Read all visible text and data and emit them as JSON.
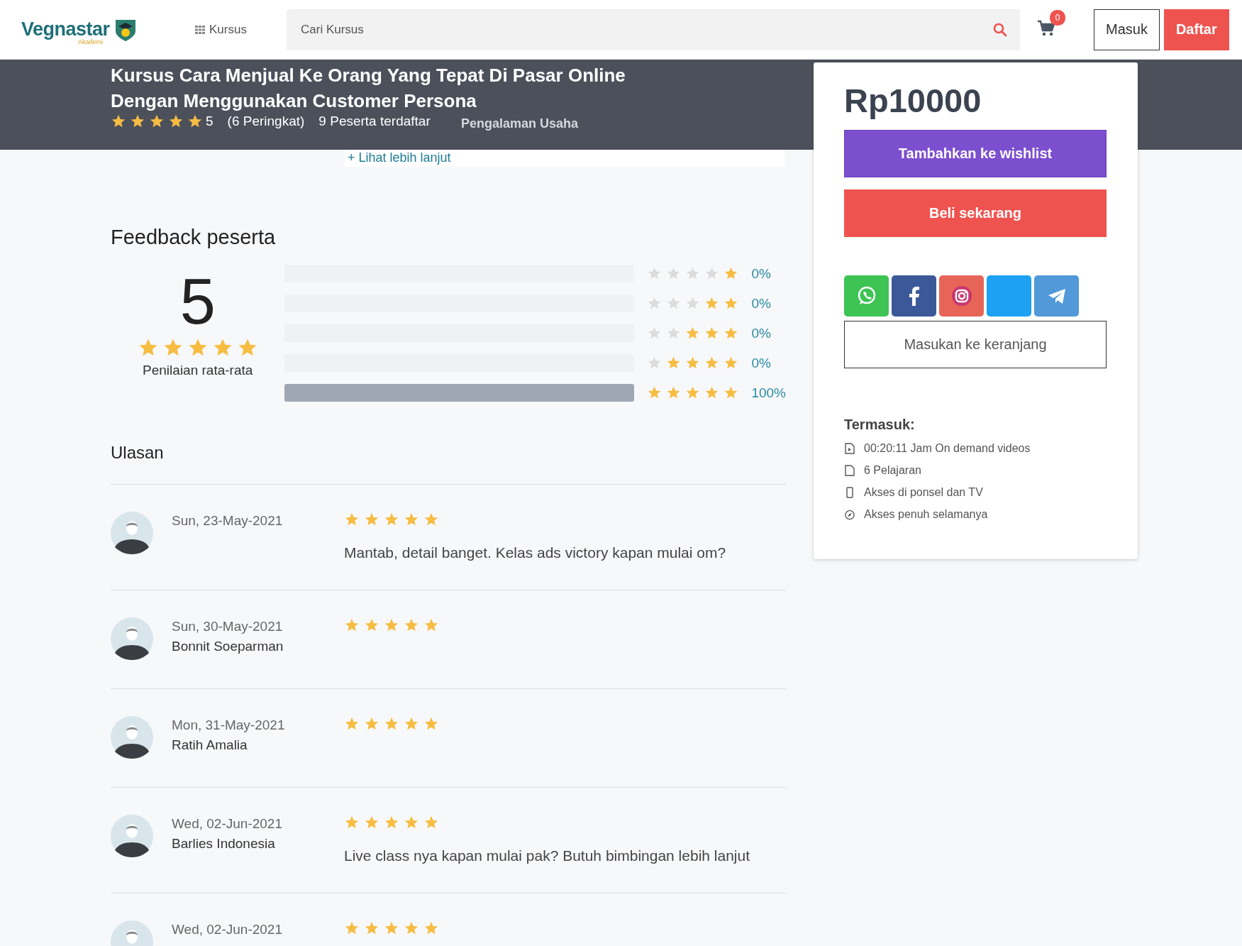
{
  "header": {
    "logo": {
      "name": "Vegnastar",
      "tagline": "Akademi"
    },
    "nav_link": "Kursus",
    "search": {
      "placeholder": "Cari Kursus"
    },
    "cart": {
      "count": "0"
    },
    "buttons": [
      {
        "label": "Masuk",
        "kind": "outline"
      },
      {
        "label": "Daftar",
        "kind": "primary"
      }
    ]
  },
  "course": {
    "title": "Kursus Cara Menjual Ke Orang Yang Tepat Di Pasar Online Dengan Menggunakan Customer Persona",
    "stars": 5,
    "rating": "5",
    "ratings_count": "(6 Peringkat)",
    "enrolled": "9 Peserta terdaftar"
  },
  "about_fragment": {
    "heading": "Pengalaman Usaha",
    "link": "+ Lihat lebih lanjut"
  },
  "feedback": {
    "title": "Feedback peserta",
    "average": "5",
    "stars": 5,
    "average_label": "Penilaian rata-rata",
    "breakdown": [
      {
        "stars": 1,
        "level": 0,
        "percent": "0%"
      },
      {
        "stars": 2,
        "level": 0,
        "percent": "0%"
      },
      {
        "stars": 3,
        "level": 0,
        "percent": "0%"
      },
      {
        "stars": 4,
        "level": 0,
        "percent": "0%"
      },
      {
        "stars": 5,
        "level": 1,
        "percent": "100%"
      }
    ]
  },
  "reviews": {
    "title": "Ulasan",
    "items": [
      {
        "date": "Sun, 23-May-2021",
        "stars": 5,
        "comment": "Mantab, detail banget. Kelas ads victory kapan mulai om?"
      },
      {
        "date": "Sun, 30-May-2021",
        "name": "Bonnit Soeparman",
        "stars": 5
      },
      {
        "date": "Mon, 31-May-2021",
        "name": "Ratih Amalia",
        "stars": 5
      },
      {
        "date": "Wed, 02-Jun-2021",
        "name": "Barlies Indonesia",
        "stars": 5,
        "comment": "Live class nya kapan mulai pak? Butuh bimbingan lebih lanjut"
      },
      {
        "date": "Wed, 02-Jun-2021",
        "stars": 5
      }
    ]
  },
  "sidebar": {
    "price": "Rp10000",
    "wishlist_button": "Tambahkan ke wishlist",
    "buy_button": "Beli sekarang",
    "share": [
      {
        "kind": "whatsapp"
      },
      {
        "kind": "facebook"
      },
      {
        "kind": "instagram"
      },
      {
        "kind": "twitter"
      },
      {
        "kind": "telegram"
      }
    ],
    "cart_button": "Masukan ke keranjang",
    "includes_title": "Termasuk:",
    "includes": [
      {
        "kind": "video",
        "text": "00:20:11 Jam On demand videos"
      },
      {
        "kind": "file",
        "text": "6 Pelajaran"
      },
      {
        "kind": "mobile",
        "text": "Akses di ponsel dan TV"
      },
      {
        "kind": "compass",
        "text": "Akses penuh selamanya"
      }
    ]
  }
}
